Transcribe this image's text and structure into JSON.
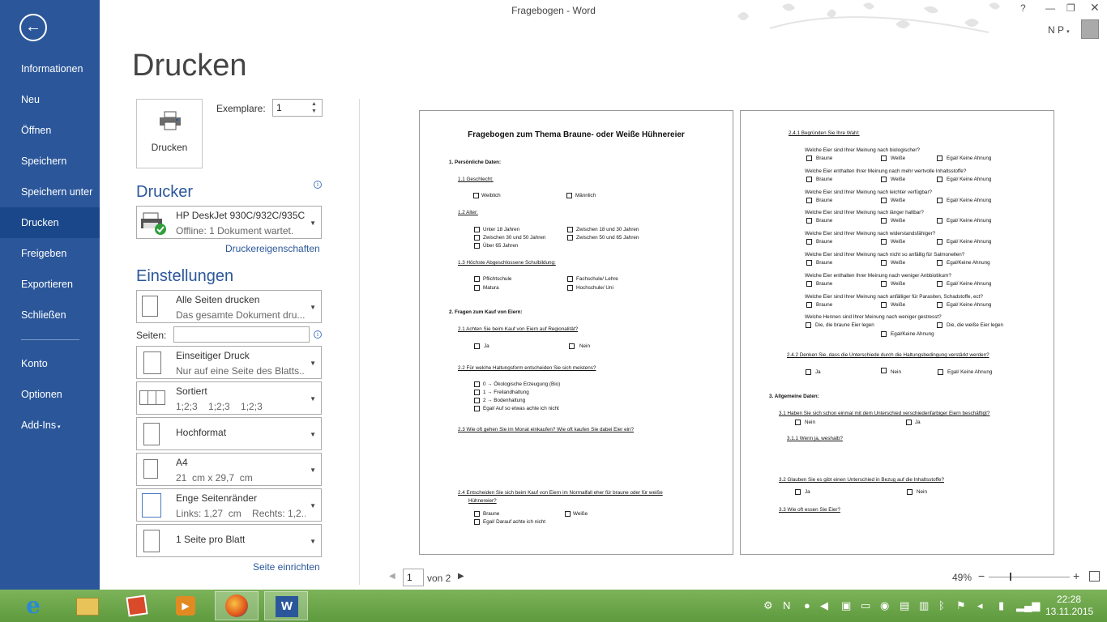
{
  "window": {
    "title": "Fragebogen - Word",
    "help": "?",
    "user": "N P"
  },
  "sidebar": {
    "back_icon": "back-arrow-icon",
    "items": [
      "Informationen",
      "Neu",
      "Öffnen",
      "Speichern",
      "Speichern unter",
      "Drucken",
      "Freigeben",
      "Exportieren",
      "Schließen",
      "Konto",
      "Optionen",
      "Add-Ins"
    ],
    "selected": "Drucken"
  },
  "print": {
    "heading": "Drucken",
    "button_label": "Drucken",
    "copies_label": "Exemplare:",
    "copies_value": "1",
    "printer_section": "Drucker",
    "printer_name": "HP DeskJet 930C/932C/935C",
    "printer_status": "Offline: 1 Dokument wartet.",
    "printer_props": "Druckereigenschaften",
    "settings_section": "Einstellungen",
    "pages_label": "Seiten:",
    "pages_value": "",
    "page_setup": "Seite einrichten",
    "settings": [
      {
        "title": "Alle Seiten drucken",
        "sub": "Das gesamte Dokument dru..."
      },
      {
        "title": "Einseitiger Druck",
        "sub": "Nur auf eine Seite des Blatts..."
      },
      {
        "title": "Sortiert",
        "sub": "1;2;3    1;2;3    1;2;3"
      },
      {
        "title": "Hochformat",
        "sub": ""
      },
      {
        "title": "A4",
        "sub": "21  cm x 29,7  cm"
      },
      {
        "title": "Enge Seitenränder",
        "sub": "Links: 1,27  cm    Rechts: 1,2..."
      },
      {
        "title": "1 Seite pro Blatt",
        "sub": ""
      }
    ]
  },
  "preview": {
    "page1": {
      "title": "Fragebogen zum Thema Braune- oder Weiße Hühnereier",
      "s1": "1.   Persönliche Daten:",
      "q11": "1.1  Geschlecht:",
      "weiblich": "Weiblich",
      "maennlich": "Männlich",
      "q12": "1.2 Alter:",
      "a1": "Unter 18 Jahren",
      "a2": "Zwischen 18 und 30 Jahren",
      "a3": "Zwischen 30 und 50 Jahren",
      "a4": "Zwischen 50 und 65 Jahren",
      "a5": "Über 65 Jahren",
      "q13": "1.3 Höchste Abgeschlossene Schulbildung:",
      "b1": "Pflichtschule",
      "b2": "Fachschule/ Lehre",
      "b3": "Matura",
      "b4": "Hochschule/ Uni",
      "s2": "2.   Fragen zum Kauf von Eiern:",
      "q21": "2.1 Achten Sie beim Kauf von Eiern auf Regionalität?",
      "ja": "Ja",
      "nein": "Nein",
      "q22": "2.2 Für welche Haltungsform entscheiden Sie sich meistens?",
      "h0": "0 → Ökologische Erzeugung (Bio)",
      "h1": "1 → Freilandhaltung",
      "h2": "2 → Bodenhaltung",
      "h3": "Egal/ Auf so etwas achte ich nicht",
      "q23": "2.3 Wie oft gehen Sie im Monat einkaufen? Wie oft kaufen Sie dabei Eier ein?",
      "q24a": "2.4 Entscheiden Sie sich beim Kauf von Eiern im Normalfall eher für braune oder für weiße",
      "q24b": "Hühnereier?",
      "braune": "Braune",
      "weisse": "Weiße",
      "egal_darauf": "Egal/ Darauf achte ich nicht"
    },
    "page2": {
      "q241": "2.4.1 Begründen Sie Ihre Wahl:",
      "rows": [
        {
          "q": "Welche Eier sind Ihrer Meinung nach biologischer?",
          "o3": "Egal/ Keine Ahnung"
        },
        {
          "q": "Welche Eier enthalten Ihrer Meinung nach mehr wertvolle Inhaltsstoffe?",
          "o3": "Egal/ Keine Ahnung"
        },
        {
          "q": "Welche Eier sind Ihrer Meinung nach leichter verfügbar?",
          "o3": "Egal/ Keine Ahnung"
        },
        {
          "q": "Welche Eier sind Ihrer Meinung nach länger haltbar?",
          "o3": "Egal/ Keine Ahnung"
        },
        {
          "q": "Welche Eier sind Ihrer Meinung nach widerstandsfähiger?",
          "o3": "Egal/ Keine Ahnung"
        },
        {
          "q": "Welche Eier sind Ihrer Meinung nach nicht so anfällig für Salmonellen?",
          "o3": "Egal/Keine Ahnung"
        },
        {
          "q": "Welche Eier enthalten Ihrer Meinung nach weniger Anbbiotikum?",
          "o3": "Egal/ Keine Ahnung"
        },
        {
          "q": "Welche Eier sind Ihrer Meinung nach anfälliger für Parasiten, Schadstoffe, ect?",
          "o3": "Egal/ Keine Ahnung"
        }
      ],
      "braune": "Braune",
      "weisse": "Weiße",
      "hennen_q": "Welche Hennen sind Ihrer Meinung nach weniger gestresst?",
      "hennen1": "Die, die braune Eier legen",
      "hennen2": "Die, die weiße Eier legen",
      "hennen3": "Egal/Keine Ahnung",
      "q242": "2.4.2 Denken Sie, dass die Unterschiede durch die Haltungsbedingung verstärkt werden?",
      "ja": "Ja",
      "nein": "Nein",
      "egal": "Egal/ Keine Ahnung",
      "s3": "3.   Allgemeine Daten:",
      "q31": "3.1 Haben Sie sich schon einmal mit dem Unterschied verschiedenfarbiger Eiern beschäftigt?",
      "q311": "3.1.1 Wenn ja, weshalb?",
      "q32": "3.2 Glauben Sie es gibt einen Unterschied in Bezug auf die Inhaltsstoffe?",
      "q33": "3.3 Wie oft essen Sie Eier?"
    }
  },
  "footer": {
    "page_value": "1",
    "page_of": "von 2",
    "zoom": "49%"
  },
  "taskbar": {
    "time": "22:28",
    "date": "13.11.2015"
  },
  "colors": {
    "accent": "#2b579a",
    "sidebar_selected": "#19478a",
    "taskbar": "#6aa648"
  }
}
